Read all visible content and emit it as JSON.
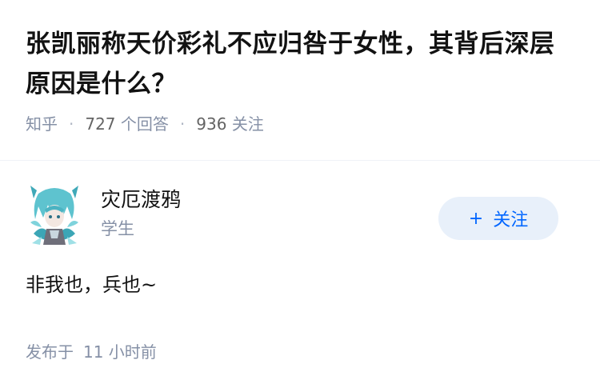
{
  "question": {
    "title": "张凯丽称天价彩礼不应归咎于女性，其背后深层原因是什么？",
    "source": "知乎",
    "answers_count": "727",
    "answers_label": "个回答",
    "followers_count": "936",
    "followers_label": "关注"
  },
  "answer": {
    "author_name": "灾厄渡鸦",
    "author_bio": "学生",
    "follow_label": "关注",
    "content": "非我也，兵也~",
    "published_prefix": "发布于",
    "published_time": "11 小时前"
  },
  "colors": {
    "accent": "#0066ff",
    "follow_bg": "#e8f0fa",
    "meta_gray": "#8590a6"
  },
  "icons": {
    "avatar": "anime-avatar-icon",
    "follow": "plus-icon"
  }
}
